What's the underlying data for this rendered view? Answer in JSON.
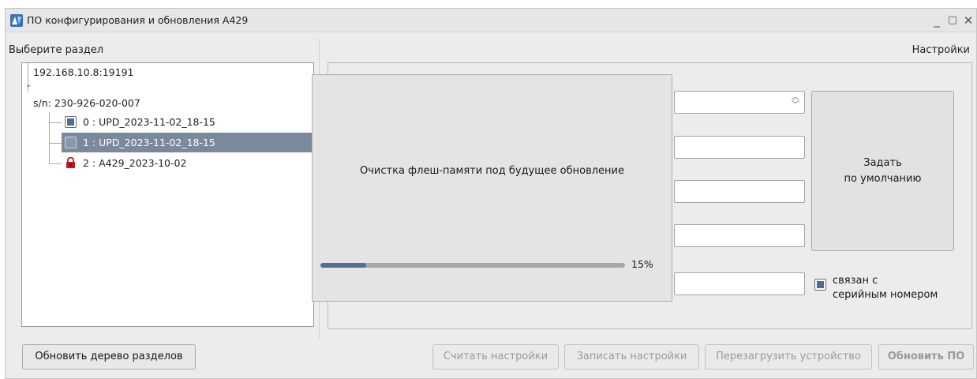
{
  "window": {
    "title": "ПО конфигурирования и обновления A429",
    "minimize_glyph": "_",
    "maximize_glyph": "▢",
    "close_glyph": "✕"
  },
  "left_panel": {
    "label": "Выберите раздел",
    "tree": {
      "host": "192.168.10.8:19191",
      "device": "s/n: 230-926-020-007",
      "partitions": [
        {
          "label": "0 : UPD_2023-11-02_18-15",
          "checked": true,
          "icon": "checkbox",
          "selected": false
        },
        {
          "label": "1 : UPD_2023-11-02_18-15",
          "checked": false,
          "icon": "checkbox",
          "selected": true
        },
        {
          "label": "2 : A429_2023-10-02",
          "checked": null,
          "icon": "lock-icon",
          "selected": false
        }
      ]
    },
    "refresh_button": "Обновить дерево разделов"
  },
  "right_panel": {
    "label": "Настройки",
    "default_button_line1": "Задать",
    "default_button_line2": "по умолчанию",
    "serial_checkbox_line1": "связан с",
    "serial_checkbox_line2": "серийным номером",
    "serial_checked": true
  },
  "progress_dialog": {
    "message": "Очистка флеш-памяти под будущее обновление",
    "progress_fraction": 0.15,
    "progress_text": "15%"
  },
  "footer_buttons": {
    "read_settings": "Считать настройки",
    "write_settings": "Записать настройки",
    "reboot_device": "Перезагрузить устройство",
    "update_firmware": "Обновить ПО"
  },
  "colors": {
    "accent": "#4e6e9c",
    "selection": "#7a8a9c",
    "lock_red": "#c8141e"
  }
}
